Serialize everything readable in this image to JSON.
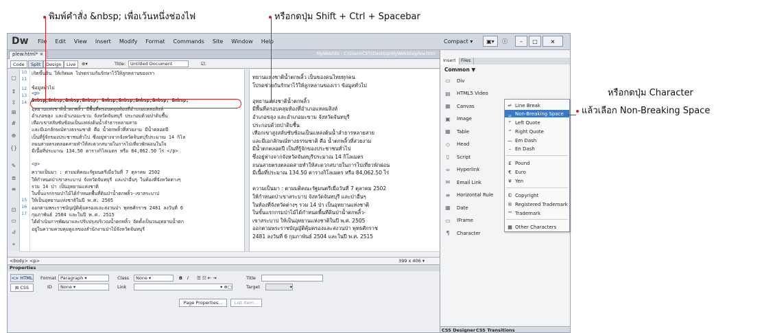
{
  "annotations": {
    "top_left": "พิมพ์คำสั่ง &nbsp; เพื่อเว้นหนึ่งช่องไฟ",
    "top_right": "หรือกดปุ่ม Shift + Ctrl + Spacebar",
    "right_1": "หรือกดปุ่ม Character",
    "right_2": "แล้วเลือก Non-Breaking Space"
  },
  "app": {
    "logo": "Dw",
    "menu": [
      "File",
      "Edit",
      "View",
      "Insert",
      "Modify",
      "Format",
      "Commands",
      "Site",
      "Window",
      "Help"
    ],
    "workspace": "Compact",
    "layout_btn": "▣▾",
    "win_min": "–",
    "win_max": "□",
    "win_close": "×"
  },
  "document": {
    "tab": "plew.html* ×",
    "path": "MyWebSite - C:\\Users\\CSTI\\Desktop\\MyWebSite\\plew.html"
  },
  "toolbar": {
    "code": "Code",
    "split": "Split",
    "design": "Design",
    "live": "Live",
    "title_label": "Title:",
    "title_value": "Untitled Document"
  },
  "code": {
    "line_numbers": [
      "10",
      "11",
      "12",
      "13",
      "14",
      "15",
      "16",
      "17"
    ],
    "lines": [
      "เกิดขึ้นต้น ให้เกิดผล โปรดร่วมกันรักษาไว้ให้ลูกหลานของเรา",
      "",
      "ข้อมูลทั่วไป",
      "<p>",
      "&nbsp;&nbsp;&nbsp;&nbsp; &nbsp;&nbsp;&nbsp;&nbsp; &nbsp;",
      "อุทยานแห่งชาติน้ำตกพลิ้ว มีพื้นที่ครอบคลุมท้องที่อำเภอแหลมสิงห์",
      "อำเภอขลุง และอำเภอมะขาม จังหวัดจันทบุรี ประกอบด้วยป่าดิบชื้น",
      "เทือกเขาสลับซับซ้อนเป็นแหล่งต้นน้ำลำธารหลายสาย",
      "และมีเอกลักษณ์ทางธรรมชาติ คือ น้ำตกพลิ้วที่สวยงาม มีน้ำตลอดปี",
      "เป็นที่รู้จักของประชาชนทั่วไป ซึ่งอยู่ห่างจากจังหวัดจันทบุรีประมาณ 14 กิโล",
      "ถนนสายตรงตลอดสายทำให้สะดวกสบายในการไปเที่ยวพักผ่อนในใจ",
      "มีเนื้อที่ประมาณ 134.50 ตารางกิโลเมตร หรือ 84,062.50 ไร่ </p>",
      "",
      "<p>",
      "ความเป็นมา : ตามมติคณะรัฐมนตรีเมื่อวันที่ 7 ตุลาคม 2502",
      "ให้กำหนดป่าเขาสระบาป จังหวัดจันทบุรี และป่าอื่นๆ ในท้องที่จังหวัดต่างๆ",
      "รวม 14 ป่า เป็นอุทยานแห่งชาติ",
      "ในขั้นแรกกรมป่าไม้ได้กำหนดพื้นที่ดินป่าน้ำตกพลิ้ว-เขาสระบาป",
      "ให้เป็นอุทยานแห่งชาติในปี พ.ศ. 2505",
      "ออกตามพระราชบัญญัติคุ้มครองและสงวนป่า พุทธศักราช 2481 ลงวันที่ 6",
      "กุมภาพันธ์ 2504 และในปี พ.ศ. 2515",
      "ได้ดำเนินการพัฒนาและปรับปรุงบริเวณน้ำตกพลิ้ว จัดตั้งเป็นวนอุทยานน้ำตก",
      "อยู่ในความควบคุมดูแลของสำนักงานป่าไม้จังหวัดจันทบุรี"
    ]
  },
  "design": {
    "lines": [
      "ทยานแห่งชาติน้ำตกพลิ้ว เป็นของคนไทยทุกคน",
      "โปรดช่วยกันรักษาไว้ให้ลูกหลานของเรา ข้อมูลทั่วไป",
      "",
      "        อุทยานแห่งชาติน้ำตกพลิ้ว",
      "มีพื้นที่ครอบคลุมท้องที่อำเภอแหลมสิงห์",
      "อำเภอขลุง และอำเภอมะขาม จังหวัดจันทบุรี",
      "ประกอบด้วยป่าดิบชื้น",
      "เทือกเขาสูงสลับซับซ้อนเป็นแหล่งต้นน้ำลำธารหลายสาย",
      "และมีเอกลักษณ์ทางธรรมชาติ คือ น้ำตกพลิ้วที่สวยงาม",
      "มีน้ำตกตลอดปี เป็นที่รู้จักของประชาชนทั่วไป",
      "ซึ่งอยู่ห่างจากจังหวัดจันทบุรีประมาณ 14 กิโลเมตร",
      "ถนนสายตรงตลอดสายทำให้สะดวกสบายในการไปเที่ยวพักผ่อน",
      "มีเนื้อที่ประมาณ 134.50 ตารางกิโลเมตร หรือ 84,062.50 ไร่",
      "",
      "ความเป็นมา : ตามมติคณะรัฐมนตรีเมื่อวันที่ 7 ตุลาคม 2502",
      "ให้กำหนดป่าเขาสระบาป จังหวัดจันทบุรี และป่าอื่นๆ",
      "ในท้องที่จังหวัดต่างๆ รวม 14 ป่า เป็นอุทยานแห่งชาติ",
      "ในขั้นแรกกรมป่าไม้ได้กำหนดพื้นที่ดินป่าน้ำตกพลิ้ว-",
      "เขาสระบาป ให้เป็นอุทยานแห่งชาติในปี พ.ศ. 2505",
      "ออกตามพระราชบัญญัติคุ้มครองและสงวนป่า พุทธศักราช",
      "2481 ลงวันที่ 6 กุมภาพันธ์ 2504 และในปี พ.ศ. 2515"
    ]
  },
  "status": {
    "tag_path": "<body> <p>",
    "size": "399 x 406 ▾"
  },
  "properties": {
    "header": "Properties",
    "html_btn": "<> HTML",
    "css_btn": "⊞ CSS",
    "format_label": "Format",
    "format_value": "Paragraph",
    "class_label": "Class",
    "class_value": "None",
    "id_label": "ID",
    "id_value": "None",
    "link_label": "Link",
    "title_label": "Title",
    "target_label": "Target",
    "page_props": "Page Properties...",
    "list_item": "List Item..."
  },
  "insert_panel": {
    "tabs": [
      "Insert",
      "Files"
    ],
    "category": "Common ▼",
    "items": [
      "Div",
      "HTML5 Video",
      "Canvas",
      "Image",
      "Table",
      "Head",
      "Script",
      "Hyperlink",
      "Email Link",
      "Horizontal Rule",
      "Date",
      "IFrame",
      "Character"
    ],
    "icons": [
      "▭",
      "▤",
      "▦",
      "▣",
      "▦",
      "◇",
      "▯",
      "∞",
      "✉",
      "≡",
      "▦",
      "▭",
      "¶"
    ]
  },
  "character_menu": {
    "items": [
      "Line Break",
      "Non-Breaking Space",
      "Left Quote",
      "Right Quote",
      "Em Dash",
      "En Dash",
      "Pound",
      "Euro",
      "Yen",
      "Copyright",
      "Registered Trademark",
      "Trademark",
      "Other Characters"
    ],
    "icons": [
      "↵",
      "␣",
      "“",
      "”",
      "—",
      "–",
      "£",
      "€",
      "¥",
      "©",
      "®",
      "™",
      "▦"
    ],
    "selected": "Non-Breaking Space"
  },
  "bottom_tabs": [
    "CSS Designer",
    "CSS Transitions"
  ]
}
